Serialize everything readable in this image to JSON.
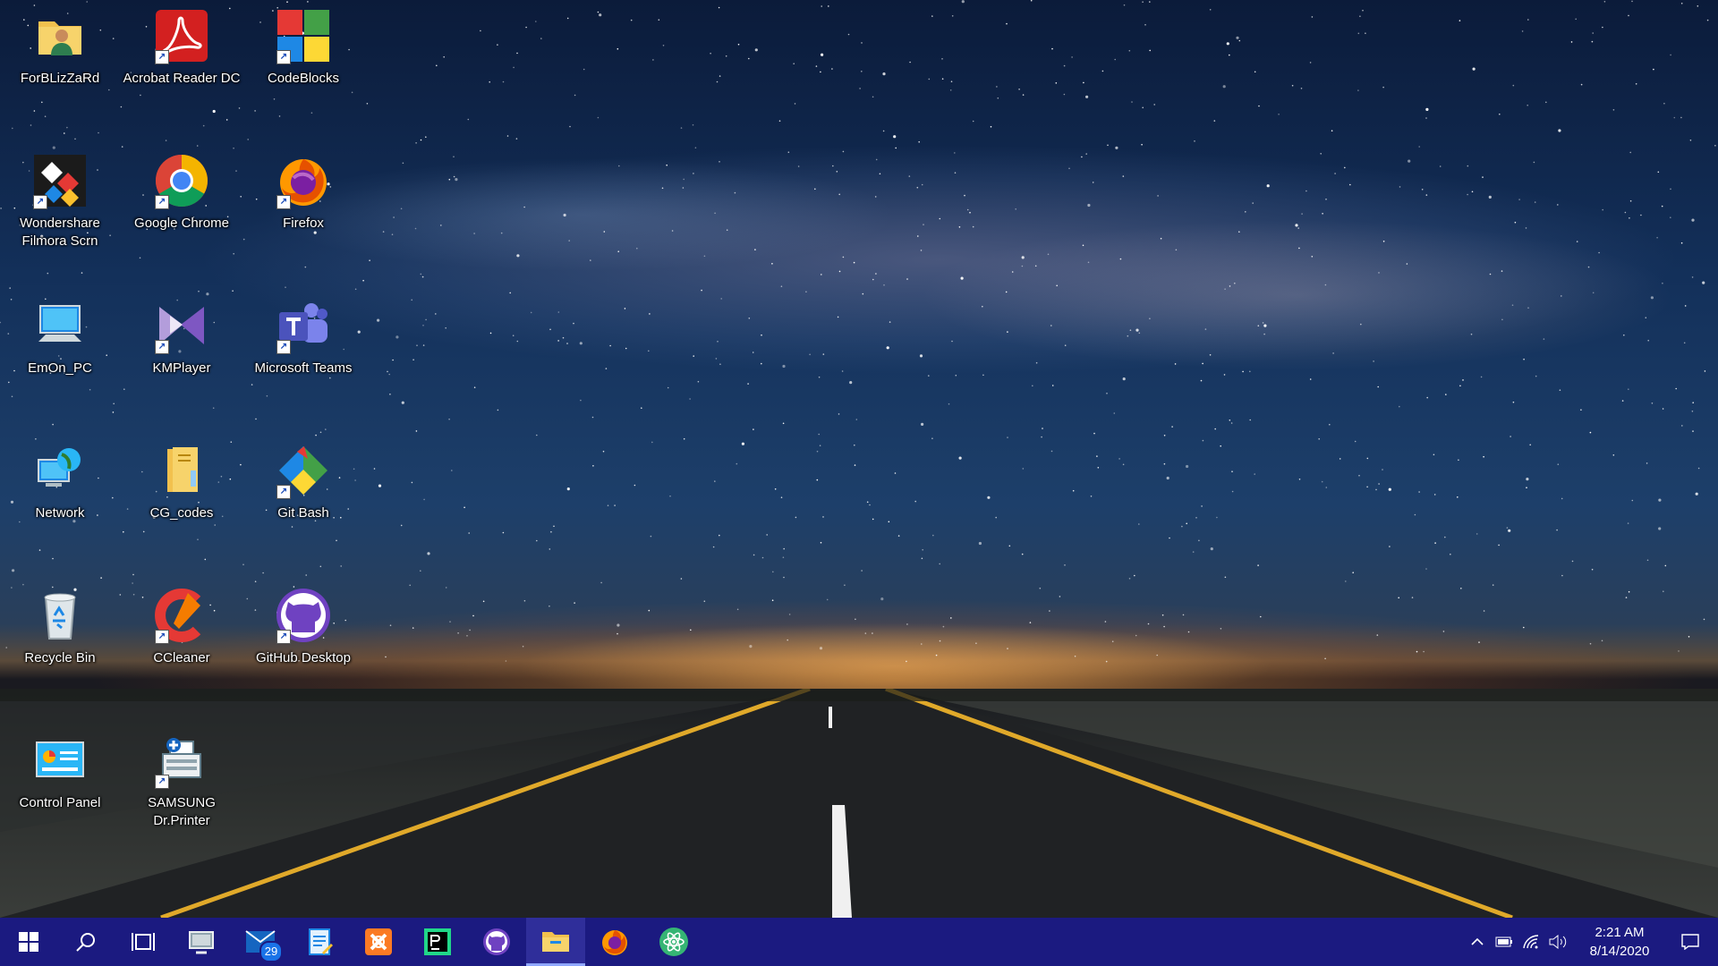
{
  "desktop": {
    "icons": [
      {
        "label": "ForBLizZaRd",
        "icon": "user-folder-icon"
      },
      {
        "label": "Acrobat Reader DC",
        "icon": "acrobat-icon"
      },
      {
        "label": "CodeBlocks",
        "icon": "codeblocks-icon"
      },
      {
        "label": "Wondershare Filmora Scrn",
        "icon": "filmora-icon"
      },
      {
        "label": "Google Chrome",
        "icon": "chrome-icon"
      },
      {
        "label": "Firefox",
        "icon": "firefox-icon"
      },
      {
        "label": "EmOn_PC",
        "icon": "computer-icon"
      },
      {
        "label": "KMPlayer",
        "icon": "kmplayer-icon"
      },
      {
        "label": "Microsoft Teams",
        "icon": "teams-icon"
      },
      {
        "label": "Network",
        "icon": "network-icon"
      },
      {
        "label": "CG_codes",
        "icon": "folder-icon"
      },
      {
        "label": "Git Bash",
        "icon": "git-bash-icon"
      },
      {
        "label": "Recycle Bin",
        "icon": "recycle-bin-icon"
      },
      {
        "label": "CCleaner",
        "icon": "ccleaner-icon"
      },
      {
        "label": "GitHub Desktop",
        "icon": "github-desktop-icon"
      },
      {
        "label": "Control Panel",
        "icon": "control-panel-icon"
      },
      {
        "label": "SAMSUNG Dr.Printer",
        "icon": "samsung-printer-icon"
      }
    ]
  },
  "taskbar": {
    "start_icon": "windows-start-icon",
    "search_icon": "search-icon",
    "taskview_icon": "task-view-icon",
    "pinned": [
      {
        "name": "remote-desktop-icon"
      },
      {
        "name": "mail-icon",
        "badge": "29"
      },
      {
        "name": "notepad-icon"
      },
      {
        "name": "xampp-icon"
      },
      {
        "name": "pycharm-icon"
      },
      {
        "name": "github-desktop-icon"
      },
      {
        "name": "file-explorer-icon",
        "active": true
      },
      {
        "name": "firefox-icon"
      },
      {
        "name": "atom-icon"
      }
    ],
    "tray": {
      "time": "2:21 AM",
      "date": "8/14/2020"
    }
  },
  "colors": {
    "taskbar": "#1b1a80",
    "taskbar_active": "#2f2e9a"
  }
}
